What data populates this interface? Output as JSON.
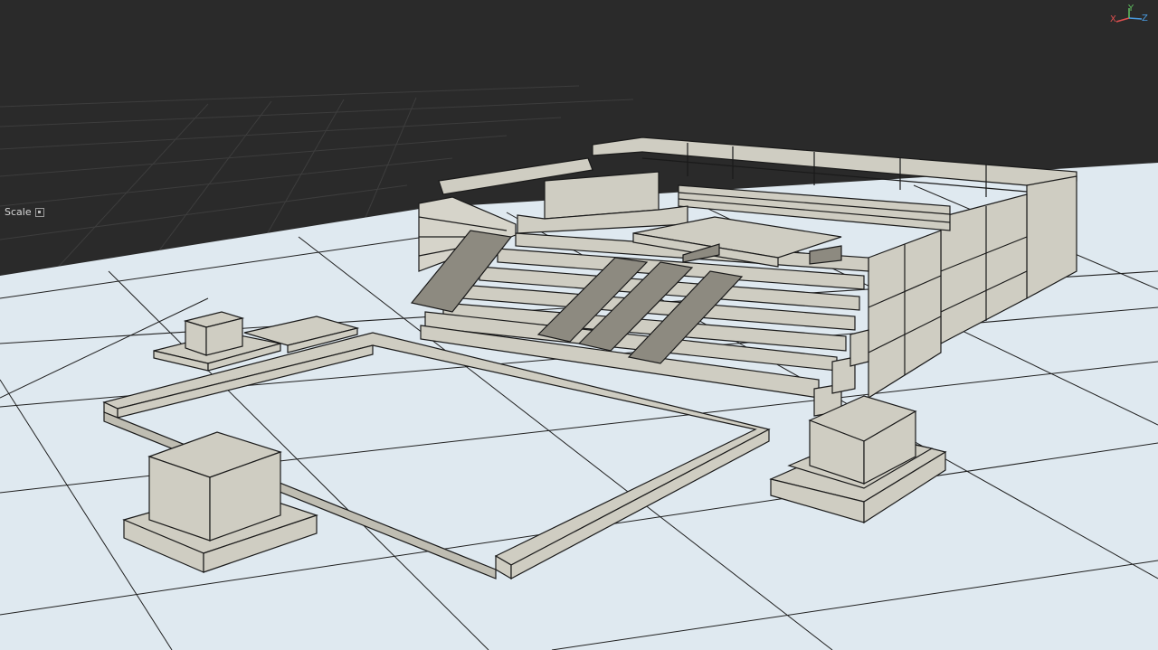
{
  "viewport": {
    "label": "Scale",
    "background_color": "#2a2a2a",
    "ground_color": "#dfe9f0",
    "model_color": "#cfcdc2",
    "line_color": "#1a1a1a"
  },
  "gizmo": {
    "x_label": "X",
    "y_label": "Y",
    "z_label": "Z",
    "x_color": "#e05050",
    "y_color": "#60c060",
    "z_color": "#4a9be0"
  },
  "icons": [
    "scale-mode-icon",
    "axis-gizmo-icon"
  ]
}
